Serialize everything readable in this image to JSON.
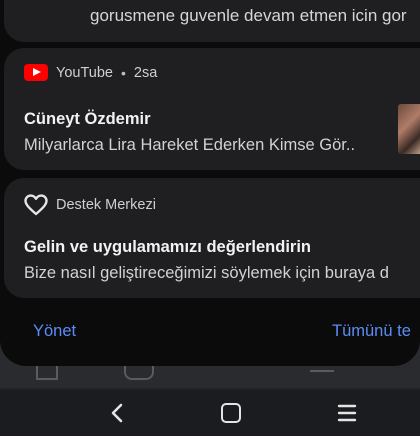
{
  "colors": {
    "background": "#0b0b0c",
    "card": "#1f1f21",
    "accent_link": "#5c8df6",
    "youtube_red": "#ff0000"
  },
  "notifications": [
    {
      "text": "gorusmene guvenle devam etmen icin gor"
    },
    {
      "app_icon": "youtube-icon",
      "app_name": "YouTube",
      "separator": "•",
      "time": "2sa",
      "title": "Cüneyt Özdemir",
      "body": "Milyarlarca Lira Hareket Ederken Kimse Gör.."
    },
    {
      "app_icon": "heart-icon",
      "app_name": "Destek Merkezi",
      "title": "Gelin ve uygulamamızı değerlendirin",
      "body": "Bize nasıl geliştireceğimizi söylemek için buraya d"
    }
  ],
  "footer": {
    "manage_label": "Yönet",
    "clear_all_label": "Tümünü te"
  },
  "navbar": {
    "back_icon": "back-chevron-icon",
    "home_icon": "home-square-icon",
    "recents_icon": "recents-lines-icon"
  }
}
